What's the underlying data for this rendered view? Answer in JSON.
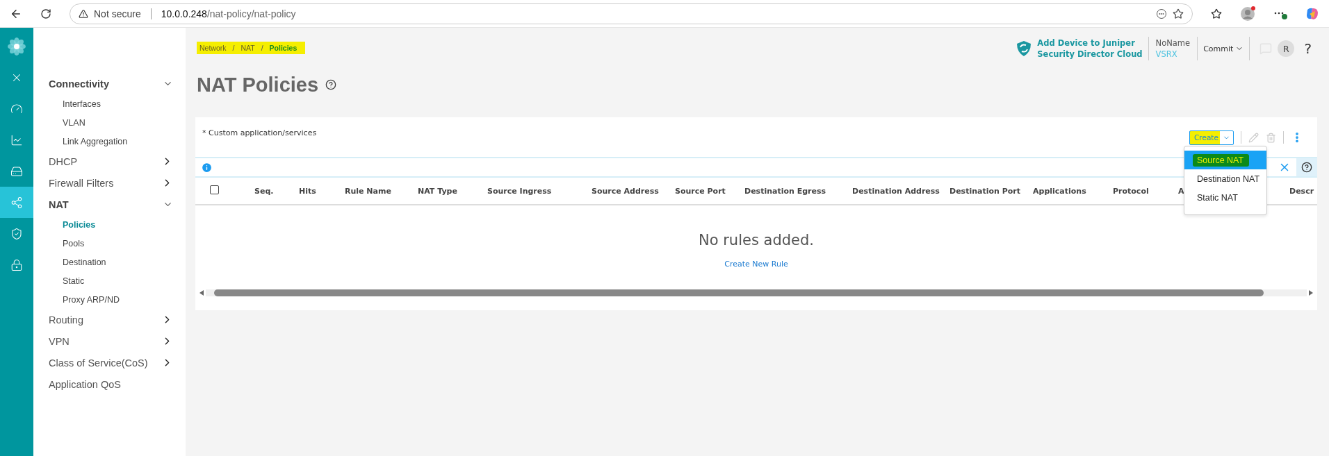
{
  "browser": {
    "security": "Not secure",
    "url_host": "10.0.0.248",
    "url_path": "/nat-policy/nat-policy"
  },
  "rail": [
    {
      "selected": false
    },
    {
      "selected": false
    },
    {
      "selected": false
    },
    {
      "selected": false
    },
    {
      "selected": false
    },
    {
      "selected": true
    },
    {
      "selected": false
    },
    {
      "selected": false
    }
  ],
  "sidebar": {
    "groups": [
      {
        "label": "Connectivity",
        "expandable": true,
        "expanded": true,
        "children": [
          {
            "label": "Interfaces",
            "selected": false
          },
          {
            "label": "VLAN",
            "selected": false
          },
          {
            "label": "Link Aggregation",
            "selected": false
          }
        ]
      },
      {
        "label": "DHCP",
        "expandable": true,
        "expanded": false
      },
      {
        "label": "Firewall Filters",
        "expandable": true,
        "expanded": false
      },
      {
        "label": "NAT",
        "expandable": true,
        "expanded": true,
        "children": [
          {
            "label": "Policies",
            "selected": true
          },
          {
            "label": "Pools",
            "selected": false
          },
          {
            "label": "Destination",
            "selected": false
          },
          {
            "label": "Static",
            "selected": false
          },
          {
            "label": "Proxy ARP/ND",
            "selected": false
          }
        ]
      },
      {
        "label": "Routing",
        "expandable": true,
        "expanded": false
      },
      {
        "label": "VPN",
        "expandable": true,
        "expanded": false
      },
      {
        "label": "Class of Service(CoS)",
        "expandable": true,
        "expanded": false
      },
      {
        "label": "Application QoS",
        "expandable": false,
        "expanded": false
      }
    ]
  },
  "breadcrumb": {
    "highlighted": true,
    "separator": "/",
    "items": [
      "Network",
      "NAT",
      "Policies"
    ]
  },
  "header": {
    "promo": [
      "Add Device to Juniper",
      "Security Director Cloud"
    ],
    "device_name": "NoName",
    "device_model": "VSRX",
    "commit": "Commit",
    "avatar": "R",
    "help": "?"
  },
  "title": "NAT Policies",
  "card": {
    "note": "* Custom application/services",
    "create": {
      "label": "Create",
      "highlighted": true
    },
    "menu": [
      {
        "label": "Source NAT",
        "selected": true,
        "highlighted": true
      },
      {
        "label": "Destination NAT",
        "selected": false,
        "highlighted": false
      },
      {
        "label": "Static NAT",
        "selected": false,
        "highlighted": false
      }
    ],
    "columns": [
      "Seq.",
      "Hits",
      "Rule Name",
      "NAT Type",
      "Source Ingress",
      "Source Address",
      "Source Port",
      "Destination Egress",
      "Destination Address",
      "Destination Port",
      "Applications",
      "Protocol",
      "A",
      "Descr"
    ],
    "select_all": {
      "checked": false
    },
    "empty_message": "No rules added.",
    "empty_link": "Create New Rule"
  }
}
